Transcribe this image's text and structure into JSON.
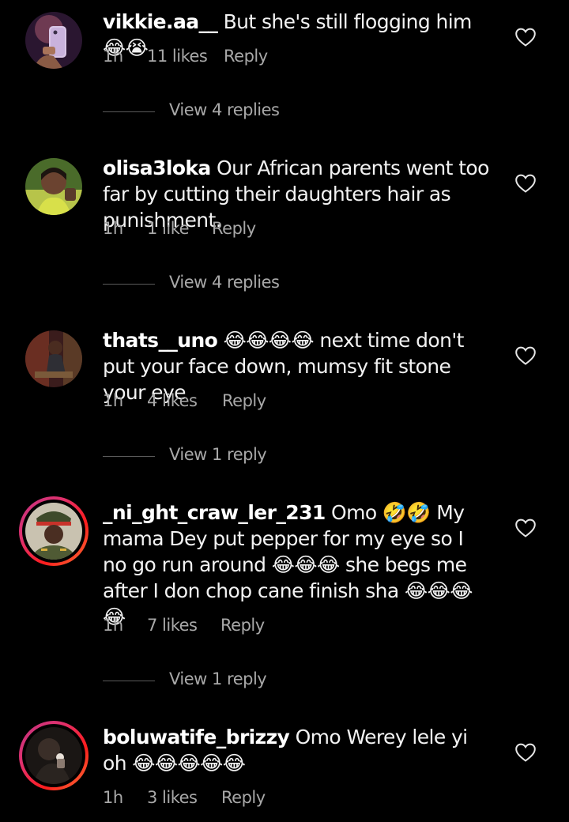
{
  "colors": {
    "background": "#000000",
    "text": "#f2f2f2",
    "muted": "#a8a8a8",
    "divider": "#5a5a5a",
    "story_ring": "#e1306c"
  },
  "comments": [
    {
      "username": "vikkie.aa__",
      "body": " But she's still flogging him😂😭",
      "time": "1h",
      "likes": "11 likes",
      "reply": "Reply",
      "view_replies": "View 4 replies",
      "icon": "heart-outline-icon"
    },
    {
      "username": "olisa3loka",
      "body": " Our African parents went too far by cutting their daughters hair as punishment.",
      "time": "1h",
      "likes": "1 like",
      "reply": "Reply",
      "view_replies": "View 4 replies",
      "icon": "heart-outline-icon"
    },
    {
      "username": "thats__uno",
      "body": " 😂😂😂😂 next time don't put your face down, mumsy fit stone your eye",
      "time": "1h",
      "likes": "4 likes",
      "reply": "Reply",
      "view_replies": "View 1 reply",
      "icon": "heart-outline-icon"
    },
    {
      "username": "_ni_ght_craw_ler_231",
      "body": " Omo 🤣🤣 My mama Dey put pepper for my eye so I no go run around 😂😂😂 she begs me after I don chop cane finish sha 😂😂😂😂",
      "time": "1h",
      "likes": "7 likes",
      "reply": "Reply",
      "view_replies": "View 1 reply",
      "icon": "heart-outline-icon"
    },
    {
      "username": "boluwatife_brizzy",
      "body": " Omo Werey lele yi oh 😂😂😂😂😂",
      "time": "1h",
      "likes": "3 likes",
      "reply": "Reply",
      "icon": "heart-outline-icon"
    }
  ]
}
